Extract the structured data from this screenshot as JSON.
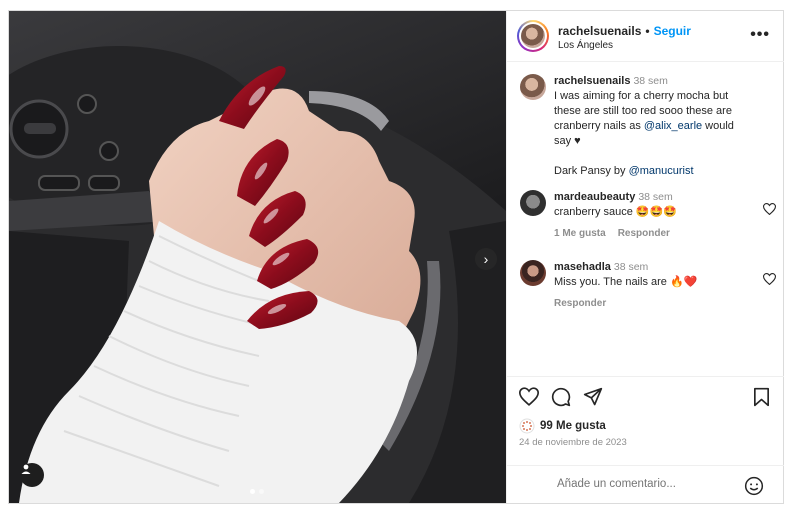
{
  "post": {
    "username": "rachelsuenails",
    "follow_label": "Seguir",
    "location": "Los Ángeles",
    "separator": "•"
  },
  "caption": {
    "username": "rachelsuenails",
    "time": "38 sem",
    "text_1": "I was aiming for a cherry mocha but these are still too red sooo these are cranberry nails as ",
    "mention_1": "@alix_earle",
    "text_2": " would say ♥",
    "text_3": "Dark Pansy by ",
    "mention_2": "@manucurist"
  },
  "comments": [
    {
      "username": "mardeaubeauty",
      "time": "38 sem",
      "text": "cranberry sauce 🤩🤩🤩",
      "likes_label": "1 Me gusta",
      "reply_label": "Responder"
    },
    {
      "username": "masehadla",
      "time": "38 sem",
      "text": "Miss you. The nails are 🔥❤️",
      "reply_label": "Responder"
    }
  ],
  "footer": {
    "likes": "99 Me gusta",
    "date": "24 de noviembre de 2023",
    "comment_placeholder": "Añade un comentario..."
  },
  "carousel": {
    "total": 2,
    "current": 1
  },
  "colors": {
    "accent": "#0095f6",
    "nail_red": "#8b0c1c",
    "sweater": "#f2f2f2"
  }
}
